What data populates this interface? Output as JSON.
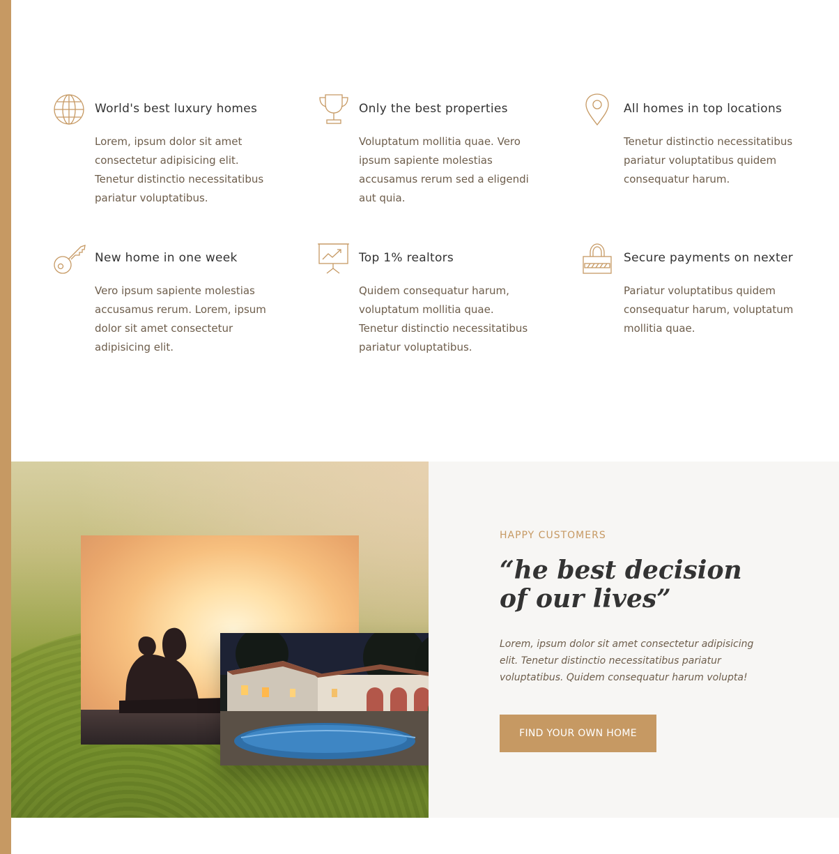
{
  "theme": {
    "accent": "#c69963",
    "heading": "#333333",
    "text": "#6d5d4b",
    "panel": "#f7f6f4"
  },
  "features": [
    {
      "icon": "globe-icon",
      "title": "World's best luxury homes",
      "text": "Lorem, ipsum dolor sit amet consectetur adipisicing elit. Tenetur distinctio necessitatibus pariatur voluptatibus."
    },
    {
      "icon": "trophy-icon",
      "title": "Only the best properties",
      "text": "Voluptatum mollitia quae. Vero ipsum sapiente molestias accusamus rerum sed a eligendi aut quia."
    },
    {
      "icon": "map-pin-icon",
      "title": "All homes in top locations",
      "text": "Tenetur distinctio necessitatibus pariatur voluptatibus quidem consequatur harum."
    },
    {
      "icon": "key-icon",
      "title": "New home in one week",
      "text": "Vero ipsum sapiente molestias accusamus rerum. Lorem, ipsum dolor sit amet consectetur adipisicing elit."
    },
    {
      "icon": "presentation-chart-icon",
      "title": "Top 1% realtors",
      "text": "Quidem consequatur harum, voluptatum mollitia quae. Tenetur distinctio necessitatibus pariatur voluptatibus."
    },
    {
      "icon": "padlock-icon",
      "title": "Secure payments on nexter",
      "text": "Pariatur voluptatibus quidem consequatur harum, voluptatum mollitia quae."
    }
  ],
  "testimonial": {
    "eyebrow": "HAPPY CUSTOMERS",
    "quote": "“he best decision of our lives”",
    "body": "Lorem, ipsum dolor sit amet consectetur adipisicing elit. Tenetur distinctio necessitatibus pariatur voluptatibus. Quidem consequatur harum volupta!",
    "cta_label": "FIND YOUR OWN HOME"
  }
}
